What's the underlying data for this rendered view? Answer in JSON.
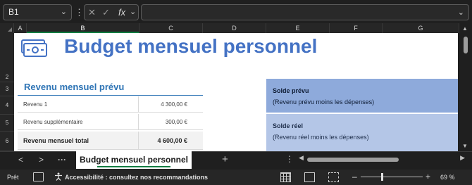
{
  "formula_bar": {
    "name_box": "B1",
    "cancel_glyph": "✕",
    "enter_glyph": "✓",
    "fx_glyph": "fx",
    "formula_value": ""
  },
  "columns": [
    "A",
    "B",
    "C",
    "D",
    "E",
    "F",
    "G"
  ],
  "rows": [
    "2",
    "3",
    "4",
    "5",
    "6"
  ],
  "sheet": {
    "title": "Budget mensuel personnel",
    "title_color": "#4472c4",
    "income_section": {
      "title": "Revenu mensuel prévu",
      "rows": [
        {
          "label": "Revenu 1",
          "value": "4 300,00 €"
        },
        {
          "label": "Revenu supplémentaire",
          "value": "300,00 €"
        }
      ],
      "total": {
        "label": "Revenu mensuel total",
        "value": "4 600,00 €"
      }
    },
    "balance_planned": {
      "title": "Solde prévu",
      "subtitle": "(Revenu prévu moins les dépenses)",
      "color": "#8eaadb"
    },
    "balance_actual": {
      "title": "Solde réel",
      "subtitle": "(Revenu réel moins les dépenses)",
      "color": "#b4c6e7"
    }
  },
  "tabs": {
    "prev": "<",
    "next": ">",
    "more": "···",
    "active_sheet": "Budget mensuel personnel",
    "add": "+",
    "overflow": "⋮"
  },
  "status_bar": {
    "ready": "Prêt",
    "accessibility": "Accessibilité : consultez nos recommandations",
    "zoom": "69 %",
    "zoom_minus": "–",
    "zoom_plus": "+"
  }
}
